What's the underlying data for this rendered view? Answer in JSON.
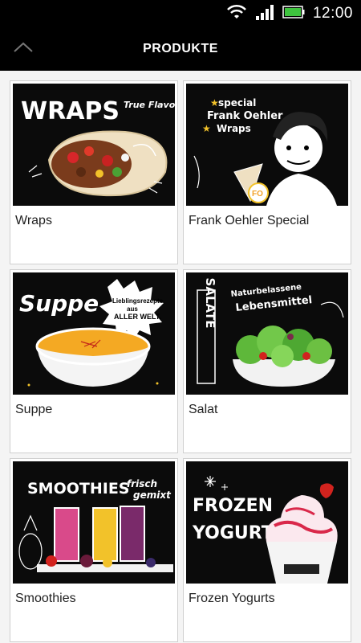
{
  "status_bar": {
    "time": "12:00",
    "icons": [
      "wifi-icon",
      "signal-icon",
      "battery-icon"
    ],
    "battery_color": "#3fc43f"
  },
  "action_bar": {
    "title": "PRODUKTE",
    "up_icon": "chevron-up-icon"
  },
  "products": [
    {
      "label": "Wraps",
      "image_text": [
        "WRAPS",
        "True Flavor"
      ]
    },
    {
      "label": "Frank Oehler Special",
      "image_text": [
        "special",
        "Frank Oehler",
        "Wraps",
        "FO"
      ]
    },
    {
      "label": "Suppe",
      "image_text": [
        "Suppe",
        "Lieblingsrezepte",
        "aus",
        "ALLER WELT."
      ]
    },
    {
      "label": "Salat",
      "image_text": [
        "SALATE",
        "Naturbelassene",
        "Lebensmittel"
      ]
    },
    {
      "label": "Smoothies",
      "image_text": [
        "SMOOTHIES",
        "frisch",
        "gemixt"
      ]
    },
    {
      "label": "Frozen Yogurts",
      "image_text": [
        "FROZEN",
        "YOGURT"
      ]
    }
  ]
}
